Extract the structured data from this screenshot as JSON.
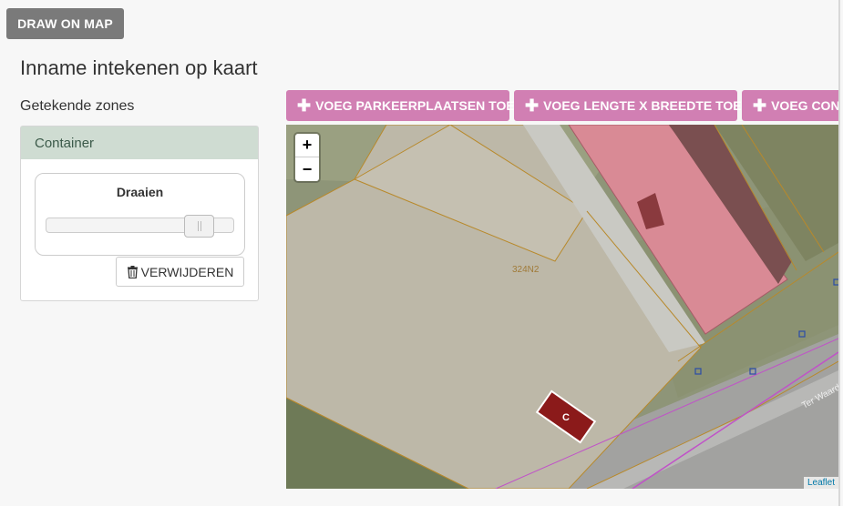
{
  "header": {
    "draw_button": "DRAW ON MAP",
    "title": "Inname intekenen op kaart",
    "zones_label": "Getekende zones"
  },
  "zone_panel": {
    "name": "Container",
    "rotate_label": "Draaien",
    "rotate_value": 0.88,
    "delete_label": "VERWIJDEREN",
    "delete_icon": "trash-icon"
  },
  "toolbar": {
    "buttons": [
      {
        "label": "VOEG PARKEERPLAATSEN TOE"
      },
      {
        "label": "VOEG LENGTE X BREEDTE TOE"
      },
      {
        "label": "VOEG CONT"
      }
    ]
  },
  "map": {
    "zoom_in": "+",
    "zoom_out": "−",
    "parcel_label": "324N2",
    "street_label": "Ter Waard",
    "container_marker_label": "C",
    "attribution": "Leaflet",
    "colors": {
      "marker": "#8b1a1a",
      "building": "#d98a95",
      "parcel_line": "#b8892b",
      "boundary_line": "#c052c8"
    }
  }
}
